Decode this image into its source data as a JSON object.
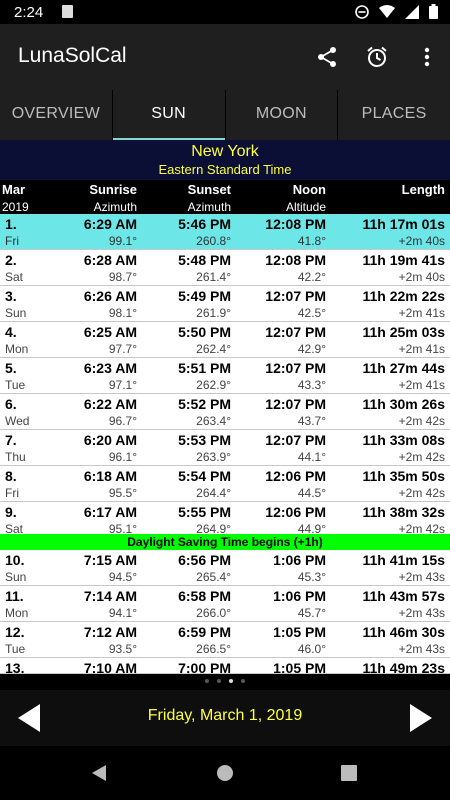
{
  "status": {
    "time": "2:24"
  },
  "app": {
    "title": "LunaSolCal"
  },
  "tabs": [
    "OVERVIEW",
    "SUN",
    "MOON",
    "PLACES"
  ],
  "location": {
    "city": "New York",
    "timezone": "Eastern Standard Time"
  },
  "header": {
    "top": {
      "date": "Mar",
      "sunrise": "Sunrise",
      "sunset": "Sunset",
      "noon": "Noon",
      "length": "Length"
    },
    "bottom": {
      "date": "2019",
      "sunrise": "Azimuth",
      "sunset": "Azimuth",
      "noon": "Altitude",
      "length": ""
    }
  },
  "rows": [
    {
      "day": "1.",
      "dow": "Fri",
      "sunrise": "6:29 AM",
      "rise_az": "99.1°",
      "sunset": "5:46 PM",
      "set_az": "260.8°",
      "noon": "12:08 PM",
      "alt": "41.8°",
      "length": "11h 17m 01s",
      "delta": "+2m 40s"
    },
    {
      "day": "2.",
      "dow": "Sat",
      "sunrise": "6:28 AM",
      "rise_az": "98.7°",
      "sunset": "5:48 PM",
      "set_az": "261.4°",
      "noon": "12:08 PM",
      "alt": "42.2°",
      "length": "11h 19m 41s",
      "delta": "+2m 40s"
    },
    {
      "day": "3.",
      "dow": "Sun",
      "sunrise": "6:26 AM",
      "rise_az": "98.1°",
      "sunset": "5:49 PM",
      "set_az": "261.9°",
      "noon": "12:07 PM",
      "alt": "42.5°",
      "length": "11h 22m 22s",
      "delta": "+2m 41s"
    },
    {
      "day": "4.",
      "dow": "Mon",
      "sunrise": "6:25 AM",
      "rise_az": "97.7°",
      "sunset": "5:50 PM",
      "set_az": "262.4°",
      "noon": "12:07 PM",
      "alt": "42.9°",
      "length": "11h 25m 03s",
      "delta": "+2m 41s"
    },
    {
      "day": "5.",
      "dow": "Tue",
      "sunrise": "6:23 AM",
      "rise_az": "97.1°",
      "sunset": "5:51 PM",
      "set_az": "262.9°",
      "noon": "12:07 PM",
      "alt": "43.3°",
      "length": "11h 27m 44s",
      "delta": "+2m 41s"
    },
    {
      "day": "6.",
      "dow": "Wed",
      "sunrise": "6:22 AM",
      "rise_az": "96.7°",
      "sunset": "5:52 PM",
      "set_az": "263.4°",
      "noon": "12:07 PM",
      "alt": "43.7°",
      "length": "11h 30m 26s",
      "delta": "+2m 42s"
    },
    {
      "day": "7.",
      "dow": "Thu",
      "sunrise": "6:20 AM",
      "rise_az": "96.1°",
      "sunset": "5:53 PM",
      "set_az": "263.9°",
      "noon": "12:07 PM",
      "alt": "44.1°",
      "length": "11h 33m 08s",
      "delta": "+2m 42s"
    },
    {
      "day": "8.",
      "dow": "Fri",
      "sunrise": "6:18 AM",
      "rise_az": "95.5°",
      "sunset": "5:54 PM",
      "set_az": "264.4°",
      "noon": "12:06 PM",
      "alt": "44.5°",
      "length": "11h 35m 50s",
      "delta": "+2m 42s"
    },
    {
      "day": "9.",
      "dow": "Sat",
      "sunrise": "6:17 AM",
      "rise_az": "95.1°",
      "sunset": "5:55 PM",
      "set_az": "264.9°",
      "noon": "12:06 PM",
      "alt": "44.9°",
      "length": "11h 38m 32s",
      "delta": "+2m 42s"
    },
    {
      "day": "10.",
      "dow": "Sun",
      "sunrise": "7:15 AM",
      "rise_az": "94.5°",
      "sunset": "6:56 PM",
      "set_az": "265.4°",
      "noon": "1:06 PM",
      "alt": "45.3°",
      "length": "11h 41m 15s",
      "delta": "+2m 43s"
    },
    {
      "day": "11.",
      "dow": "Mon",
      "sunrise": "7:14 AM",
      "rise_az": "94.1°",
      "sunset": "6:58 PM",
      "set_az": "266.0°",
      "noon": "1:06 PM",
      "alt": "45.7°",
      "length": "11h 43m 57s",
      "delta": "+2m 43s"
    },
    {
      "day": "12.",
      "dow": "Tue",
      "sunrise": "7:12 AM",
      "rise_az": "93.5°",
      "sunset": "6:59 PM",
      "set_az": "266.5°",
      "noon": "1:05 PM",
      "alt": "46.0°",
      "length": "11h 46m 30s",
      "delta": "+2m 43s"
    },
    {
      "day": "13.",
      "dow": "",
      "sunrise": "7:10 AM",
      "rise_az": "",
      "sunset": "7:00 PM",
      "set_az": "",
      "noon": "1:05 PM",
      "alt": "",
      "length": "11h 49m 23s",
      "delta": ""
    }
  ],
  "dst_banner": "Daylight Saving Time begins (+1h)",
  "selected_date": "Friday, March 1, 2019",
  "colors": {
    "highlight": "#6ce6e6",
    "dst": "#00ff00",
    "accent_text": "#ffff3c",
    "location_bg": "#0b0f35"
  }
}
